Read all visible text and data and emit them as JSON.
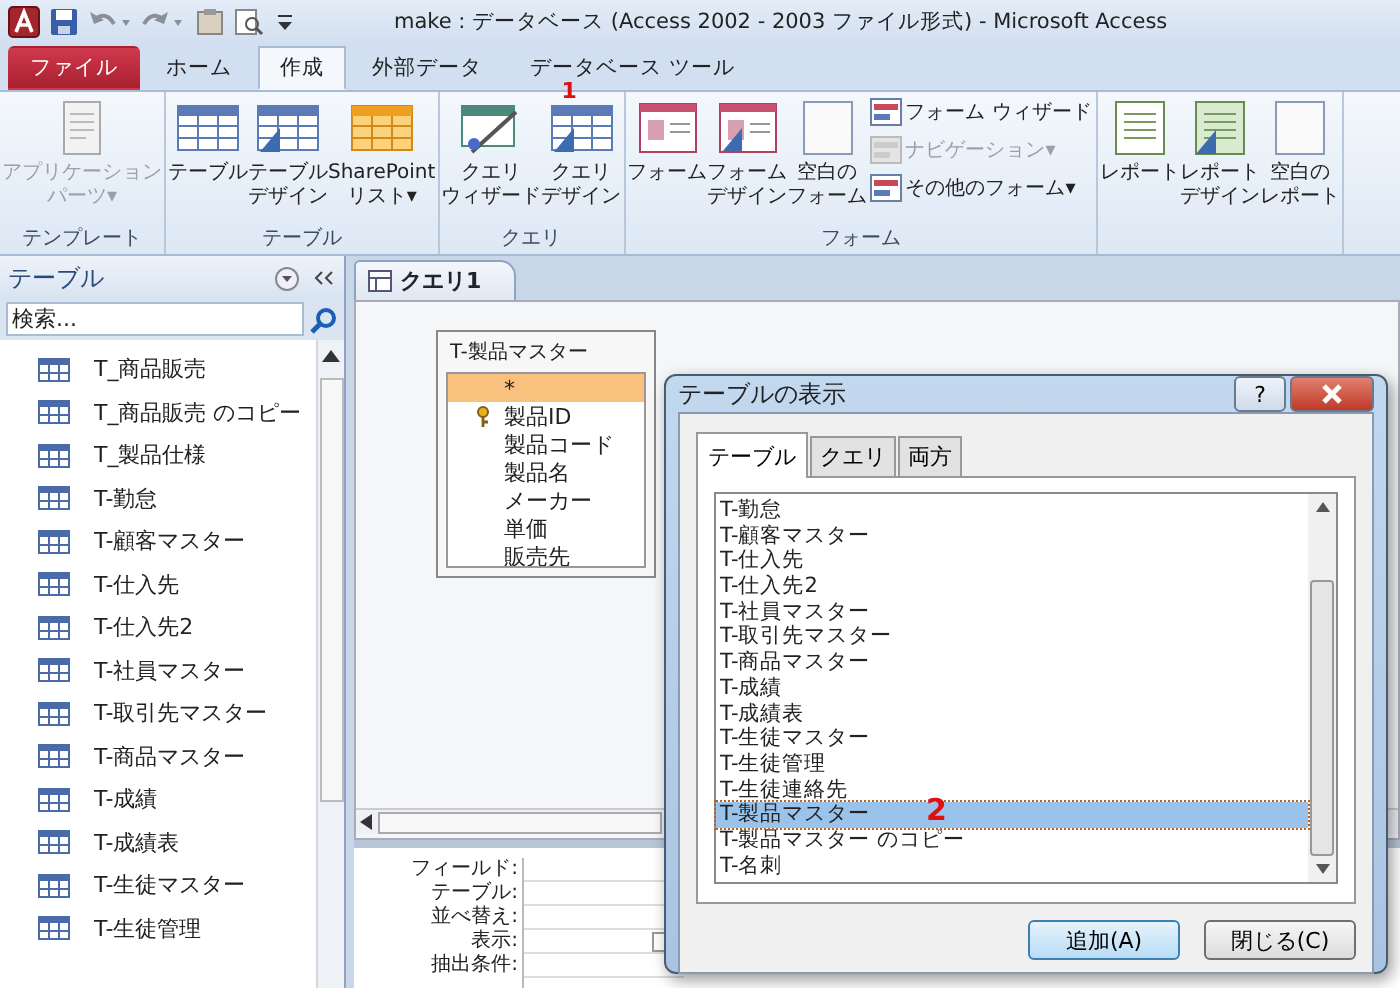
{
  "title_bar": {
    "title": "make : データベース (Access 2002 - 2003 ファイル形式)  -  Microsoft Access"
  },
  "ribbon_tabs": [
    {
      "label": "ファイル",
      "kind": "file",
      "selected": false
    },
    {
      "label": "ホーム",
      "kind": "normal",
      "selected": false
    },
    {
      "label": "作成",
      "kind": "normal",
      "selected": true
    },
    {
      "label": "外部データ",
      "kind": "normal",
      "selected": false
    },
    {
      "label": "データベース ツール",
      "kind": "normal",
      "selected": false
    }
  ],
  "ribbon_groups": [
    {
      "label": "テンプレート",
      "commands": [
        {
          "kind": "large",
          "lines": [
            "アプリケーション",
            "パーツ"
          ],
          "caret": "▾",
          "disabled": true
        }
      ]
    },
    {
      "label": "テーブル",
      "commands": [
        {
          "kind": "large",
          "lines": [
            "テーブル"
          ],
          "disabled": false
        },
        {
          "kind": "large",
          "lines": [
            "テーブル",
            "デザイン"
          ],
          "disabled": false
        },
        {
          "kind": "large",
          "lines": [
            "SharePoint",
            "リスト"
          ],
          "caret": "▾",
          "disabled": false
        }
      ]
    },
    {
      "label": "クエリ",
      "commands": [
        {
          "kind": "large",
          "lines": [
            "クエリ",
            "ウィザード"
          ],
          "disabled": false
        },
        {
          "kind": "large",
          "lines": [
            "クエリ",
            "デザイン"
          ],
          "disabled": false,
          "annotation": "1"
        }
      ]
    },
    {
      "label": "フォーム",
      "commands": [
        {
          "kind": "large",
          "lines": [
            "フォーム"
          ],
          "disabled": false
        },
        {
          "kind": "large",
          "lines": [
            "フォーム",
            "デザイン"
          ],
          "disabled": false
        },
        {
          "kind": "large",
          "lines": [
            "空白の",
            "フォーム"
          ],
          "disabled": false
        },
        {
          "kind": "small",
          "lines": [
            "フォーム ウィザード"
          ],
          "disabled": false
        },
        {
          "kind": "small",
          "lines": [
            "ナビゲーション"
          ],
          "caret": "▾",
          "disabled": true
        },
        {
          "kind": "small",
          "lines": [
            "その他のフォーム"
          ],
          "caret": "▾",
          "disabled": false
        }
      ]
    },
    {
      "commands": [
        {
          "kind": "large",
          "lines": [
            "レポート"
          ],
          "disabled": false
        },
        {
          "kind": "large",
          "lines": [
            "レポート",
            "デザイン"
          ],
          "disabled": false
        },
        {
          "kind": "large",
          "lines": [
            "空白の",
            "レポート"
          ],
          "disabled": false
        }
      ]
    }
  ],
  "nav_pane": {
    "title": "テーブル",
    "search": {
      "placeholder": "検索..."
    },
    "items": [
      {
        "label": "T_商品販売"
      },
      {
        "label": "T_商品販売 のコピー"
      },
      {
        "label": "T_製品仕様"
      },
      {
        "label": "T-勤怠"
      },
      {
        "label": "T-顧客マスター"
      },
      {
        "label": "T-仕入先"
      },
      {
        "label": "T-仕入先2"
      },
      {
        "label": "T-社員マスター"
      },
      {
        "label": "T-取引先マスター"
      },
      {
        "label": "T-商品マスター"
      },
      {
        "label": "T-成績"
      },
      {
        "label": "T-成績表"
      },
      {
        "label": "T-生徒マスター"
      },
      {
        "label": "T-生徒管理"
      }
    ]
  },
  "document_tabs": [
    {
      "label": "クエリ1",
      "selected": true
    }
  ],
  "table_box": {
    "title": "T-製品マスター",
    "fields": [
      {
        "label": "*",
        "key": false,
        "selected": true
      },
      {
        "label": "製品ID",
        "key": true,
        "selected": false
      },
      {
        "label": "製品コード",
        "key": false,
        "selected": false
      },
      {
        "label": "製品名",
        "key": false,
        "selected": false
      },
      {
        "label": "メーカー",
        "key": false,
        "selected": false
      },
      {
        "label": "単価",
        "key": false,
        "selected": false
      },
      {
        "label": "販売先",
        "key": false,
        "selected": false
      }
    ]
  },
  "design_grid": {
    "rows": [
      {
        "label": "フィールド:",
        "kind": "text"
      },
      {
        "label": "テーブル:",
        "kind": "text"
      },
      {
        "label": "並べ替え:",
        "kind": "text"
      },
      {
        "label": "表示:",
        "kind": "checkbox",
        "checked": false
      },
      {
        "label": "抽出条件:",
        "kind": "text"
      }
    ]
  },
  "dialog": {
    "title": "テーブルの表示",
    "help_button": "?",
    "tabs": [
      {
        "label": "テーブル",
        "selected": true
      },
      {
        "label": "クエリ",
        "selected": false
      },
      {
        "label": "両方",
        "selected": false
      }
    ],
    "items": [
      {
        "label": "T-勤怠",
        "selected": false
      },
      {
        "label": "T-顧客マスター",
        "selected": false
      },
      {
        "label": "T-仕入先",
        "selected": false
      },
      {
        "label": "T-仕入先2",
        "selected": false
      },
      {
        "label": "T-社員マスター",
        "selected": false
      },
      {
        "label": "T-取引先マスター",
        "selected": false
      },
      {
        "label": "T-商品マスター",
        "selected": false
      },
      {
        "label": "T-成績",
        "selected": false
      },
      {
        "label": "T-成績表",
        "selected": false
      },
      {
        "label": "T-生徒マスター",
        "selected": false
      },
      {
        "label": "T-生徒管理",
        "selected": false
      },
      {
        "label": "T-生徒連絡先",
        "selected": false
      },
      {
        "label": "T-製品マスター",
        "selected": true,
        "annotation": "2"
      },
      {
        "label": "T-製品マスター のコピー",
        "selected": false
      },
      {
        "label": "T-名刺",
        "selected": false
      }
    ],
    "buttons": [
      {
        "label": "追加(A)",
        "default": true
      },
      {
        "label": "閉じる(C)",
        "default": false
      }
    ]
  }
}
